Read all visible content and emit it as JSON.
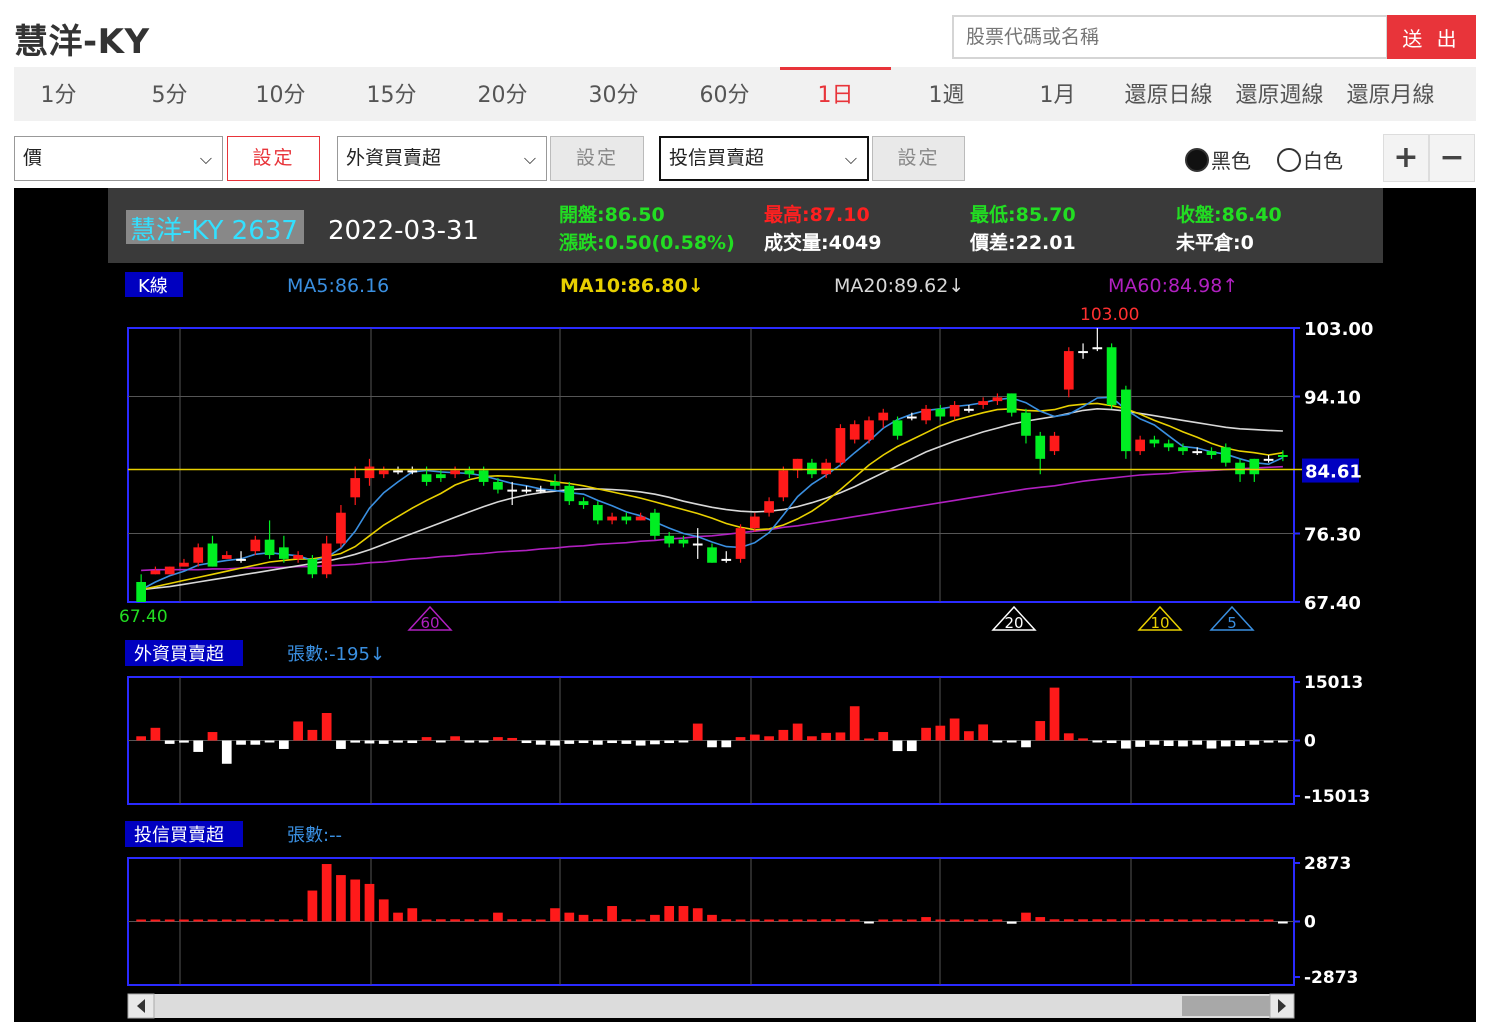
{
  "header": {
    "title": "慧洋-KY",
    "search_placeholder": "股票代碼或名稱",
    "submit_label": "送 出"
  },
  "periods": [
    "1分",
    "5分",
    "10分",
    "15分",
    "20分",
    "30分",
    "60分",
    "1日",
    "1週",
    "1月",
    "還原日線",
    "還原週線",
    "還原月線"
  ],
  "active_period": "1日",
  "controls": {
    "select1": "價",
    "select2": "外資買賣超",
    "select3": "投信買賣超",
    "set_label": "設定",
    "theme_black": "黑色",
    "theme_white": "白色",
    "zoom_in": "+",
    "zoom_out": "−"
  },
  "colors": {
    "accent": "#e8343a",
    "up": "#ff1a1a",
    "down": "#00ee22",
    "flat": "#ffffff",
    "ma5": "#3a8fe0",
    "ma10": "#e8d000",
    "ma20": "#d8d8d8",
    "ma60": "#b020c0"
  },
  "chart_data": [
    {
      "type": "candlestick",
      "info": {
        "name": "慧洋-KY 2637",
        "date": "2022-03-31",
        "open": "開盤:86.50",
        "high": "最高:87.10",
        "low": "最低:85.70",
        "close": "收盤:86.40",
        "change": "漲跌:0.50(0.58%)",
        "volume": "成交量:4049",
        "spread": "價差:22.01",
        "open_interest": "未平倉:0"
      },
      "panel_label": "K線",
      "ma_labels": [
        "MA5:86.16",
        "MA10:86.80↓",
        "MA20:89.62↓",
        "MA60:84.98↑"
      ],
      "y_ticks": [
        "103.00",
        "94.10",
        "76.30",
        "67.40"
      ],
      "ylim": [
        67.4,
        103.0
      ],
      "current_price": "84.61",
      "current_value": 84.61,
      "max_label": "103.00",
      "min_label": "67.40",
      "ma_markers": [
        "60",
        "20",
        "10",
        "5"
      ],
      "candles": [
        [
          70,
          67.4,
          71,
          67.4
        ],
        [
          71,
          71.5,
          72,
          71
        ],
        [
          71,
          72,
          72,
          71
        ],
        [
          72,
          72.5,
          73,
          72
        ],
        [
          72.5,
          74.5,
          75,
          72
        ],
        [
          75,
          72,
          76,
          72
        ],
        [
          73,
          73.5,
          74,
          73
        ],
        [
          73,
          73,
          74,
          72.5
        ],
        [
          74,
          75.5,
          76,
          73.5
        ],
        [
          75.5,
          73.5,
          78,
          73
        ],
        [
          74.5,
          73,
          76,
          72.5
        ],
        [
          73,
          73.5,
          74,
          72.5
        ],
        [
          73,
          71,
          73.5,
          70.5
        ],
        [
          71,
          75,
          76,
          70.5
        ],
        [
          75,
          79,
          80,
          74.5
        ],
        [
          81,
          83.5,
          85,
          80
        ],
        [
          83.5,
          85,
          86,
          82.5
        ],
        [
          84,
          84.5,
          85,
          83.5
        ],
        [
          84.5,
          84.5,
          85,
          84
        ],
        [
          84.5,
          84.5,
          85,
          84
        ],
        [
          84,
          83,
          85,
          82.5
        ],
        [
          84,
          83.5,
          84.5,
          83
        ],
        [
          84,
          84.5,
          85,
          83.5
        ],
        [
          84.5,
          84,
          85,
          83.5
        ],
        [
          84.5,
          83,
          85,
          82.5
        ],
        [
          83,
          82,
          83.5,
          81.5
        ],
        [
          82,
          82,
          83,
          80
        ],
        [
          82,
          82,
          82.5,
          81.5
        ],
        [
          82,
          82,
          82.5,
          81.5
        ],
        [
          83,
          82.5,
          84,
          82
        ],
        [
          82.5,
          80.5,
          83,
          80
        ],
        [
          80.5,
          80,
          81,
          79.5
        ],
        [
          80,
          78,
          80.5,
          77.5
        ],
        [
          78,
          78.5,
          79,
          77.5
        ],
        [
          78.5,
          78,
          79,
          77.5
        ],
        [
          78,
          78.5,
          79,
          78
        ],
        [
          79,
          76,
          79.5,
          75.5
        ],
        [
          76,
          75,
          76.5,
          74.5
        ],
        [
          75.5,
          75,
          76,
          74.5
        ],
        [
          75,
          75,
          77,
          73
        ],
        [
          74.5,
          72.5,
          75,
          72.5
        ],
        [
          73,
          73,
          74,
          72.5
        ],
        [
          73,
          77,
          77.5,
          72.5
        ],
        [
          77,
          78.5,
          79,
          76.5
        ],
        [
          79,
          80.5,
          81,
          78.5
        ],
        [
          81,
          84.5,
          85,
          80.5
        ],
        [
          84.5,
          86,
          86,
          83.5
        ],
        [
          85.5,
          84,
          86,
          83.5
        ],
        [
          84,
          85.5,
          86,
          83.5
        ],
        [
          85.5,
          90,
          90.5,
          85
        ],
        [
          88.5,
          90.5,
          91,
          88
        ],
        [
          88.5,
          91,
          91.5,
          88
        ],
        [
          91,
          92,
          92.5,
          90
        ],
        [
          91,
          89,
          91.5,
          88.5
        ],
        [
          91.5,
          91.5,
          92,
          91
        ],
        [
          91,
          92.5,
          93,
          90.5
        ],
        [
          92.5,
          91.5,
          93,
          91
        ],
        [
          91.5,
          93,
          93.5,
          91
        ],
        [
          92.5,
          92.5,
          93,
          92
        ],
        [
          93,
          93.5,
          94,
          92.5
        ],
        [
          93.5,
          94,
          94.5,
          93
        ],
        [
          94.5,
          92,
          94.5,
          91.5
        ],
        [
          92,
          89,
          92.5,
          88
        ],
        [
          89,
          86,
          89.5,
          84
        ],
        [
          87,
          89,
          89.5,
          86.5
        ],
        [
          95,
          100,
          100.5,
          94
        ],
        [
          100,
          100,
          101,
          99
        ],
        [
          100.5,
          100.5,
          103,
          100
        ],
        [
          100.5,
          93,
          101,
          92.5
        ],
        [
          95,
          87,
          95.5,
          86
        ],
        [
          87,
          88.5,
          89,
          86.5
        ],
        [
          88.5,
          88,
          89,
          87.5
        ],
        [
          88,
          87.5,
          88.5,
          87
        ],
        [
          87.5,
          87,
          88,
          86.5
        ],
        [
          87,
          87,
          87.5,
          86.5
        ],
        [
          87,
          86.5,
          87.5,
          86
        ],
        [
          87.5,
          85.5,
          88,
          85
        ],
        [
          85.5,
          84,
          86,
          83
        ],
        [
          86,
          84,
          86,
          83
        ],
        [
          86,
          86,
          86.5,
          85.5
        ],
        [
          86.5,
          86.4,
          87.1,
          85.7
        ]
      ],
      "ma5": [
        69,
        70,
        70.8,
        71.4,
        72.2,
        72.5,
        72.8,
        73,
        73.6,
        73.8,
        73.6,
        73.4,
        72.8,
        73.2,
        74.4,
        76.6,
        79.6,
        81.6,
        83,
        84.3,
        84.5,
        84.3,
        84.2,
        84.1,
        83.8,
        83.3,
        82.8,
        82.5,
        82.1,
        81.9,
        81.6,
        81.4,
        80.6,
        79.9,
        79.1,
        78.6,
        77.8,
        77,
        76.3,
        75.9,
        75.2,
        74.6,
        74.5,
        75.1,
        76.4,
        78.7,
        81.1,
        82.7,
        83.9,
        85.2,
        86.8,
        88.3,
        90,
        91.1,
        91.8,
        92.3,
        92.5,
        92.8,
        93,
        93.3,
        93.7,
        93.9,
        93.3,
        92.2,
        91.5,
        91.8,
        92.8,
        93.9,
        94,
        92.4,
        91.2,
        90.4,
        89,
        87.6,
        87.4,
        86.9,
        86.6,
        86,
        85.5,
        85.3,
        86.16
      ],
      "ma10": [
        69,
        69.4,
        69.8,
        70.2,
        70.6,
        71,
        71.4,
        71.8,
        72.2,
        72.6,
        72.8,
        73,
        73,
        73.3,
        73.7,
        74.6,
        76,
        77.4,
        78.5,
        79.6,
        80.6,
        81.5,
        82.6,
        83.3,
        83.7,
        83.8,
        83.7,
        83.5,
        83.3,
        83,
        82.8,
        82.5,
        82.1,
        81.7,
        81.3,
        80.9,
        80.4,
        79.9,
        79.4,
        78.9,
        78.3,
        77.6,
        77.1,
        76.8,
        76.9,
        77.4,
        78.2,
        79.2,
        80.5,
        82,
        83.6,
        85.2,
        86.5,
        87.6,
        88.5,
        89.4,
        90.3,
        91,
        91.5,
        92,
        92.4,
        92.5,
        92.3,
        92.2,
        92.4,
        92.9,
        93.1,
        93.2,
        92.9,
        92.5,
        91.8,
        91,
        90.3,
        89.5,
        88.8,
        88,
        87.4,
        87,
        86.8,
        86.5,
        86.8
      ],
      "ma20": [
        69,
        69.2,
        69.4,
        69.7,
        70,
        70.3,
        70.6,
        70.9,
        71.2,
        71.5,
        71.8,
        72.1,
        72.4,
        72.7,
        73.1,
        73.6,
        74.2,
        74.9,
        75.6,
        76.3,
        77,
        77.7,
        78.4,
        79.1,
        79.8,
        80.4,
        80.9,
        81.3,
        81.6,
        81.8,
        82,
        82.1,
        82.1,
        82,
        81.9,
        81.7,
        81.4,
        81,
        80.5,
        80.1,
        79.7,
        79.4,
        79.2,
        79.1,
        79.2,
        79.4,
        79.8,
        80.3,
        80.9,
        81.6,
        82.4,
        83.3,
        84.2,
        85.1,
        86,
        86.9,
        87.6,
        88.3,
        88.9,
        89.5,
        90,
        90.5,
        90.9,
        91.2,
        91.5,
        91.9,
        92.3,
        92.5,
        92.4,
        92.2,
        91.9,
        91.6,
        91.3,
        91,
        90.7,
        90.4,
        90.1,
        89.9,
        89.8,
        89.7,
        89.62
      ],
      "ma60": [
        71.5,
        71.6,
        71.6,
        71.6,
        71.6,
        71.7,
        71.7,
        71.8,
        71.8,
        71.9,
        71.9,
        72,
        72,
        72.1,
        72.2,
        72.3,
        72.5,
        72.6,
        72.8,
        73,
        73.1,
        73.3,
        73.4,
        73.6,
        73.7,
        73.9,
        74,
        74.1,
        74.3,
        74.4,
        74.6,
        74.7,
        74.9,
        75,
        75.1,
        75.3,
        75.4,
        75.6,
        75.7,
        75.9,
        76,
        76.2,
        76.4,
        76.6,
        76.8,
        77.1,
        77.3,
        77.6,
        77.9,
        78.2,
        78.5,
        78.8,
        79.1,
        79.4,
        79.7,
        80,
        80.3,
        80.6,
        80.9,
        81.2,
        81.5,
        81.8,
        82.1,
        82.3,
        82.5,
        82.8,
        83.1,
        83.3,
        83.5,
        83.7,
        83.9,
        84,
        84.1,
        84.3,
        84.4,
        84.5,
        84.6,
        84.7,
        84.8,
        84.9,
        84.98
      ]
    },
    {
      "type": "bar",
      "title": "外資買賣超",
      "label": "張數:-195↓",
      "y_ticks": [
        "15013",
        "0",
        "-15013"
      ],
      "ylim": [
        -15013,
        15013
      ],
      "values": [
        1000,
        3000,
        -800,
        -500,
        -2700,
        2000,
        -5500,
        -1000,
        -1000,
        -400,
        -2000,
        4500,
        2500,
        6500,
        -2000,
        -500,
        -700,
        -800,
        -500,
        -600,
        800,
        -400,
        1000,
        -500,
        -300,
        800,
        600,
        -600,
        -1000,
        -1200,
        -800,
        -600,
        -1000,
        -600,
        -800,
        -1200,
        -900,
        -600,
        -200,
        4000,
        -1600,
        -1600,
        800,
        1400,
        1000,
        2500,
        4000,
        1000,
        1800,
        1900,
        8100,
        400,
        2000,
        -2500,
        -2500,
        3000,
        3500,
        5200,
        2200,
        3800,
        -300,
        -400,
        -1600,
        4600,
        12500,
        1700,
        500,
        -400,
        -600,
        -1900,
        -1500,
        -1000,
        -1300,
        -1400,
        -1000,
        -1900,
        -1400,
        -1300,
        -1000,
        -500,
        -195
      ]
    },
    {
      "type": "bar",
      "title": "投信買賣超",
      "label": "張數:--",
      "y_ticks": [
        "2873",
        "0",
        "-2873"
      ],
      "ylim": [
        -2873,
        2873
      ],
      "values": [
        0,
        0,
        0,
        0,
        0,
        0,
        0,
        0,
        0,
        0,
        0,
        0,
        1400,
        2600,
        2100,
        1900,
        1700,
        1000,
        400,
        600,
        0,
        100,
        100,
        100,
        0,
        400,
        100,
        100,
        0,
        600,
        400,
        300,
        100,
        700,
        100,
        0,
        300,
        700,
        700,
        600,
        300,
        100,
        0,
        0,
        0,
        0,
        0,
        0,
        100,
        100,
        0,
        -60,
        0,
        0,
        0,
        200,
        0,
        0,
        0,
        0,
        0,
        -100,
        400,
        200,
        100,
        100,
        100,
        100,
        100,
        0,
        0,
        100,
        100,
        0,
        0,
        0,
        0,
        0,
        0,
        0,
        -50
      ]
    }
  ]
}
